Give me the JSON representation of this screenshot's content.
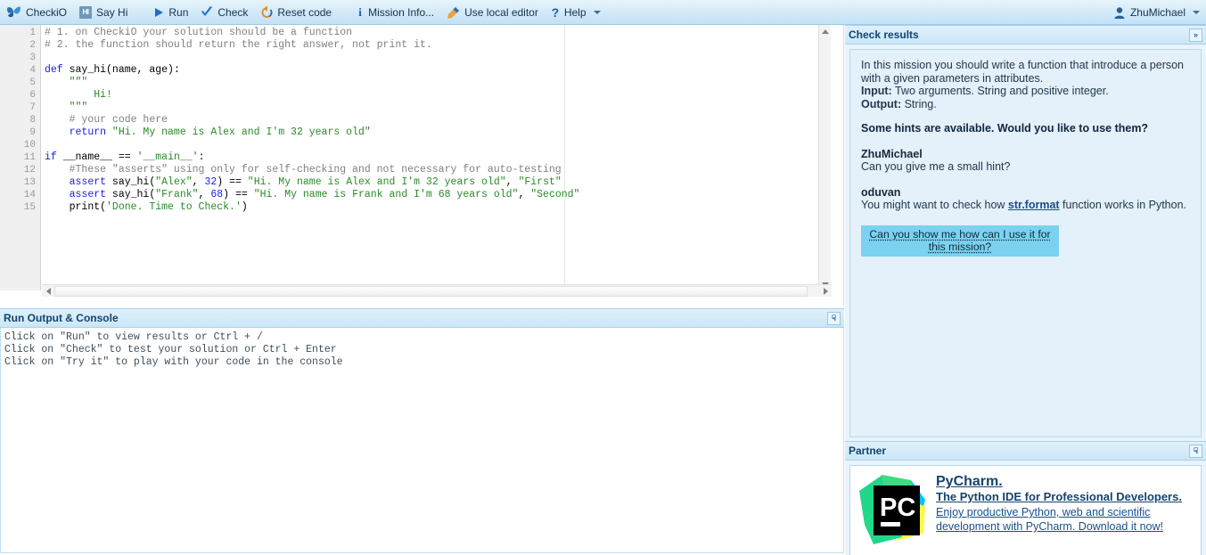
{
  "toolbar": {
    "brand": "CheckiO",
    "brand_icon": "checkio-butterfly-icon",
    "mission_badge": "HI",
    "mission_name": "Say Hi",
    "run": "Run",
    "run_icon": "play-triangle-icon",
    "check": "Check",
    "check_icon": "checkmark-icon",
    "reset": "Reset code",
    "reset_icon": "circular-arrow-icon",
    "mission_info": "Mission Info...",
    "mission_info_icon": "info-icon",
    "local_editor": "Use local editor",
    "local_editor_icon": "pencil-icon",
    "help": "Help",
    "help_icon": "question-mark-icon",
    "user": "ZhuMichael",
    "user_icon": "user-avatar-icon"
  },
  "editor": {
    "line_numbers": [
      1,
      2,
      3,
      4,
      5,
      6,
      7,
      8,
      9,
      10,
      11,
      12,
      13,
      14,
      15
    ],
    "lines": [
      [
        {
          "t": "# 1. on CheckiO your solution should be a function",
          "c": "cm-comment"
        }
      ],
      [
        {
          "t": "# 2. the function should return the right answer, not print it.",
          "c": "cm-comment"
        }
      ],
      [],
      [
        {
          "t": "def ",
          "c": "cm-keyword"
        },
        {
          "t": "say_hi",
          "c": "cm-def"
        },
        {
          "t": "(name, age):",
          "c": "cm-plain"
        }
      ],
      [
        {
          "t": "    \"\"\"",
          "c": "cm-string"
        }
      ],
      [
        {
          "t": "        Hi!",
          "c": "cm-string"
        }
      ],
      [
        {
          "t": "    \"\"\"",
          "c": "cm-string"
        }
      ],
      [
        {
          "t": "    # your code here",
          "c": "cm-comment"
        }
      ],
      [
        {
          "t": "    ",
          "c": "cm-plain"
        },
        {
          "t": "return ",
          "c": "cm-keyword"
        },
        {
          "t": "\"Hi. My name is Alex and I'm 32 years old\"",
          "c": "cm-string"
        }
      ],
      [],
      [
        {
          "t": "if ",
          "c": "cm-keyword"
        },
        {
          "t": "__name__ ",
          "c": "cm-plain"
        },
        {
          "t": "== ",
          "c": "cm-plain"
        },
        {
          "t": "'__main__'",
          "c": "cm-string"
        },
        {
          "t": ":",
          "c": "cm-plain"
        }
      ],
      [
        {
          "t": "    #These \"asserts\" using only for self-checking and not necessary for auto-testing",
          "c": "cm-comment"
        }
      ],
      [
        {
          "t": "    ",
          "c": "cm-plain"
        },
        {
          "t": "assert ",
          "c": "cm-keyword"
        },
        {
          "t": "say_hi(",
          "c": "cm-plain"
        },
        {
          "t": "\"Alex\"",
          "c": "cm-string"
        },
        {
          "t": ", ",
          "c": "cm-plain"
        },
        {
          "t": "32",
          "c": "cm-number"
        },
        {
          "t": ") == ",
          "c": "cm-plain"
        },
        {
          "t": "\"Hi. My name is Alex and I'm 32 years old\"",
          "c": "cm-string"
        },
        {
          "t": ", ",
          "c": "cm-plain"
        },
        {
          "t": "\"First\"",
          "c": "cm-string"
        }
      ],
      [
        {
          "t": "    ",
          "c": "cm-plain"
        },
        {
          "t": "assert ",
          "c": "cm-keyword"
        },
        {
          "t": "say_hi(",
          "c": "cm-plain"
        },
        {
          "t": "\"Frank\"",
          "c": "cm-string"
        },
        {
          "t": ", ",
          "c": "cm-plain"
        },
        {
          "t": "68",
          "c": "cm-number"
        },
        {
          "t": ") == ",
          "c": "cm-plain"
        },
        {
          "t": "\"Hi. My name is Frank and I'm 68 years old\"",
          "c": "cm-string"
        },
        {
          "t": ", ",
          "c": "cm-plain"
        },
        {
          "t": "\"Second\"",
          "c": "cm-string"
        }
      ],
      [
        {
          "t": "    ",
          "c": "cm-plain"
        },
        {
          "t": "print",
          "c": "cm-plain"
        },
        {
          "t": "(",
          "c": "cm-plain"
        },
        {
          "t": "'Done. Time to Check.'",
          "c": "cm-string"
        },
        {
          "t": ")",
          "c": "cm-plain"
        }
      ]
    ]
  },
  "console": {
    "title": "Run Output & Console",
    "collapse_icon": "chevron-double-down-icon",
    "lines": [
      "Click on \"Run\" to view results or Ctrl + /",
      "Click on \"Check\" to test your solution or Ctrl + Enter",
      "Click on \"Try it\" to play with your code in the console"
    ]
  },
  "check_results": {
    "title": "Check results",
    "collapse_icon": "chevron-double-right-icon",
    "intro_line1": "In this mission you should write a function that introduce a person",
    "intro_line2": "with a given parameters in attributes.",
    "input_label": "Input:",
    "input_value": " Two arguments. String and positive integer.",
    "output_label": "Output:",
    "output_value": " String.",
    "hints_question": "Some hints are available. Would you like to use them?",
    "chat": [
      {
        "author": "ZhuMichael",
        "message_before": "Can you give me a small hint?",
        "link": "",
        "message_after": ""
      },
      {
        "author": "oduvan",
        "message_before": "You might want to check how ",
        "link": "str.format",
        "message_after": " function works in Python."
      }
    ],
    "hint_button": "Can you show me how can I use it for this mission?"
  },
  "partner": {
    "title": "Partner",
    "collapse_icon": "chevron-double-down-icon",
    "logo_icon": "pycharm-logo-icon",
    "logo_text": "PC",
    "name": "PyCharm.",
    "tagline": "The Python IDE for Professional Developers.",
    "description": "Enjoy productive Python, web and scientific development with PyCharm. Download it now!"
  },
  "colors": {
    "accent": "#14436e",
    "panel_header": "#cbe7f8",
    "hint_button": "#7ad2f0",
    "link": "#1a4f8a"
  }
}
